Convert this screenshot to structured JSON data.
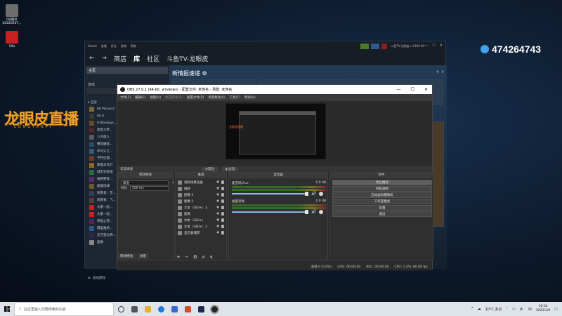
{
  "desktop": {
    "icons": [
      {
        "label_line1": "QQ图片",
        "label_line2": "20220207...",
        "color": "#6d6d6d"
      },
      {
        "label_line1": "Sifu",
        "label_line2": "",
        "color": "#c82020"
      }
    ],
    "brand_title": "龙眼皮直播",
    "brand_subtitle": "LONGYANPI",
    "qq_number": "474264743"
  },
  "steam": {
    "menu": [
      "Steam",
      "查看",
      "好友",
      "游戏",
      "帮助"
    ],
    "account_name": "斗鱼TV-龙眼皮 ▾ ¥399.00",
    "nav": {
      "back": "←",
      "forward": "→",
      "store": "商店",
      "library": "库",
      "community": "社区",
      "user": "斗鱼TV-龙眼皮"
    },
    "sidebar": {
      "home": "主页",
      "games_header": "游戏",
      "all_header": "▾ 全部",
      "games": [
        {
          "name": "60 Parsecs!",
          "color": "#7a6a3a"
        },
        {
          "name": "64.0",
          "color": "#3a3a3a"
        },
        {
          "name": "9 Monkeys...",
          "color": "#6a4a2a"
        },
        {
          "name": "暗黑大帝...",
          "color": "#4a2a2a"
        },
        {
          "name": "八方旅人",
          "color": "#5a5a5a"
        },
        {
          "name": "播放器国...",
          "color": "#2a4a6a"
        },
        {
          "name": "冰与火之...",
          "color": "#3a5a7a"
        },
        {
          "name": "不朽位面...",
          "color": "#6a3a2a"
        },
        {
          "name": "部落与弯刀",
          "color": "#8a6a2a"
        },
        {
          "name": "城市天际线",
          "color": "#2a6a4a"
        },
        {
          "name": "磁铁野冒...",
          "color": "#5a2a6a"
        },
        {
          "name": "超载地球",
          "color": "#6a5a2a"
        },
        {
          "name": "刺客者：空...",
          "color": "#3a3a5a"
        },
        {
          "name": "刺客者：飞...",
          "color": "#5a3a3a"
        },
        {
          "name": "大家一起...",
          "color": "#c82020"
        },
        {
          "name": "大家一起...",
          "color": "#c82020"
        },
        {
          "name": "帝国之怒...",
          "color": "#4a2a5a"
        },
        {
          "name": "帽里雅格...",
          "color": "#2a5a8a"
        },
        {
          "name": "东方夜光神...",
          "color": "#2a2a4a"
        },
        {
          "name": "盗贼",
          "color": "#888888"
        }
      ],
      "add_game": "添加游戏"
    },
    "main": {
      "news_header": "新情报速递 ⚙",
      "prev": "‹",
      "next": "›"
    }
  },
  "obs": {
    "title": "OBS 27.0.1 (64-bit, windows) - 配置文件: 未命名 - 场景: 未命名",
    "window_controls": {
      "min": "—",
      "max": "☐",
      "close": "✕"
    },
    "menu": [
      "文件(F)",
      "编辑(E)",
      "视图(V)",
      "停靠部件(D)",
      "配置文件(P)",
      "场景集合(S)",
      "工具(T)",
      "帮助(H)"
    ],
    "preview_tag": "龙眼皮直播",
    "source_bar": {
      "name": "未选择源",
      "properties": "属性",
      "filters": "滤镜"
    },
    "docks": {
      "scenes": "转场特效",
      "sources": "来源",
      "mixer": "混音器",
      "controls": "控件"
    },
    "transition": {
      "type": "渐变",
      "duration_label": "时长",
      "duration": "250 ms"
    },
    "sources": [
      "视频采集设备",
      "捕获",
      "图像 3",
      "图像 2",
      "文本（GDI+）3",
      "图像",
      "文本（GDI+）",
      "文本（GDI+）2",
      "显示器捕获"
    ],
    "mixer": [
      {
        "name": "麦克风/Aux",
        "db": "0.0 dB"
      },
      {
        "name": "桌面音频",
        "db": "0.0 dB"
      }
    ],
    "controls": [
      "停止推流",
      "开始录制",
      "启动虚拟摄像机",
      "工作室模式",
      "设置",
      "退出"
    ],
    "scene_tabs": [
      "转场特效",
      "场景"
    ],
    "source_tools": [
      "+",
      "−",
      "⚙",
      "∧",
      "∨"
    ],
    "status": {
      "dropped": "丢帧 0 (0.0%)",
      "live": "LIVE: 00:00:00",
      "rec": "REC: 00:00:00",
      "cpu": "CPU: 1.4%, 60.00 fps"
    }
  },
  "taskbar": {
    "search_placeholder": "在这里输入你要搜索的内容",
    "temp": "10°C 多云",
    "ime": "中",
    "time": "16:34",
    "date": "2022/2/9"
  }
}
